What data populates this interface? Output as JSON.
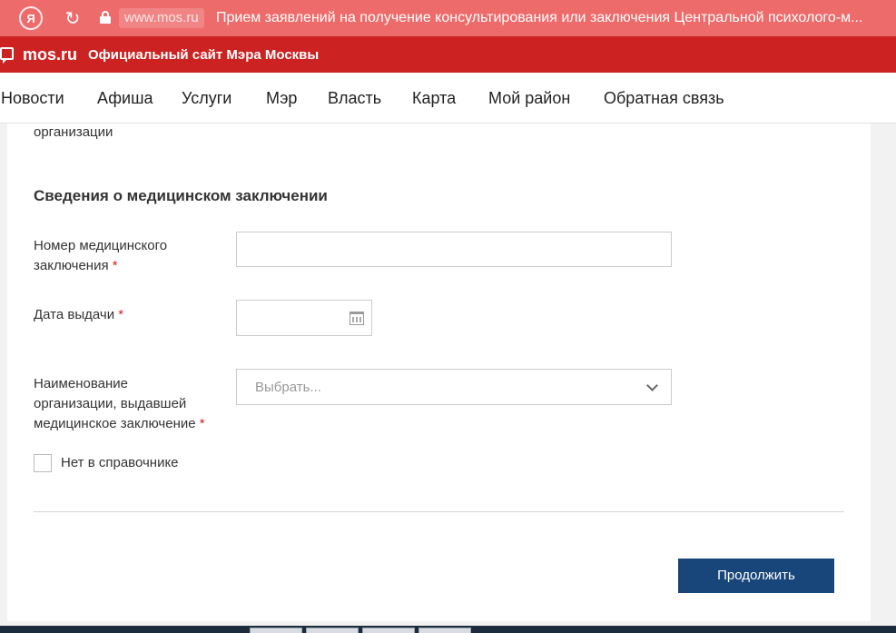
{
  "browser": {
    "yandex_icon": "Я",
    "domain": "www.mos.ru",
    "tab_title": "Прием заявлений на получение консультирования или заключения Центральной психолого-м..."
  },
  "site": {
    "logo": "mos.ru",
    "subtitle": "Официальный сайт Мэра Москвы"
  },
  "nav": {
    "items": [
      "Новости",
      "Афиша",
      "Услуги",
      "Мэр",
      "Власть",
      "Карта",
      "Мой район",
      "Обратная связь"
    ]
  },
  "form": {
    "prev_label_tail": "организации",
    "section_title": "Сведения о медицинском заключении",
    "med_number_label_l1": "Номер медицинского",
    "med_number_label_l2": "заключения",
    "med_number_value": "",
    "issue_date_label": "Дата выдачи",
    "issue_date_value": "",
    "org_label_l1": "Наименование",
    "org_label_l2": "организации, выдавшей",
    "org_label_l3": "медицинское заключение",
    "org_placeholder": "Выбрать...",
    "required_mark": "*",
    "not_in_directory_label": "Нет в справочнике",
    "not_in_directory_checked": false,
    "continue_button": "Продолжить"
  },
  "colors": {
    "browser_bar": "#ee6b6b",
    "site_header": "#cc2222",
    "primary_button": "#18457a",
    "required": "#d21f1f"
  }
}
